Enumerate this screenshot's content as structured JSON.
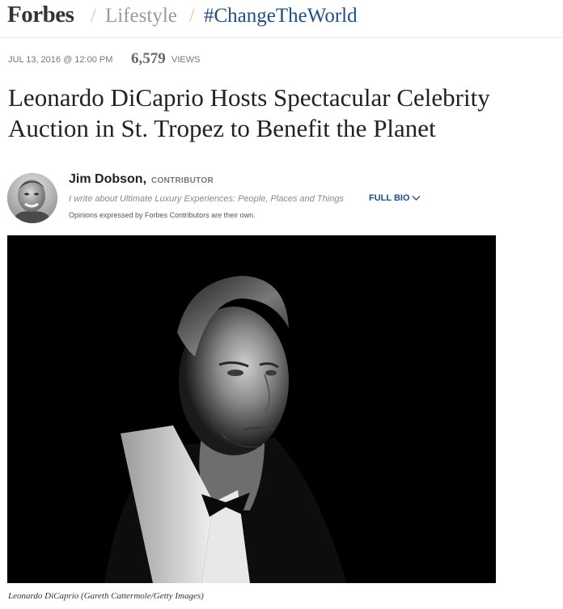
{
  "header": {
    "logo": "Forbes",
    "separator": "/",
    "section": "Lifestyle",
    "channel": "#ChangeTheWorld"
  },
  "meta": {
    "date": "JUL 13, 2016 @ 12:00 PM",
    "views_count": "6,579",
    "views_label": "VIEWS"
  },
  "article": {
    "headline": "Leonardo DiCaprio Hosts Spectacular Celebrity Auction in St. Tropez to Benefit the Planet"
  },
  "author": {
    "name": "Jim Dobson,",
    "role": "CONTRIBUTOR",
    "description": "I write about Ultimate Luxury Experiences: People, Places and Things",
    "full_bio_label": "FULL BIO",
    "opinions": "Opinions expressed by Forbes Contributors are their own."
  },
  "image": {
    "caption": "Leonardo DiCaprio (Gareth Cattermole/Getty Images)"
  },
  "colors": {
    "link_blue": "#1d4f86",
    "muted_gray": "#999999",
    "text_dark": "#222222"
  },
  "icons": {
    "full_bio": "chevron-down-icon"
  }
}
